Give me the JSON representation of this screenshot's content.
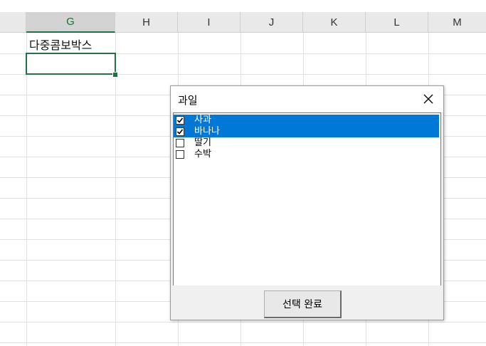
{
  "columns": [
    "G",
    "H",
    "I",
    "J",
    "K",
    "L",
    "M"
  ],
  "selected_column": "G",
  "cell_g1_text": "다중콤보박스",
  "dialog": {
    "title": "과일",
    "close_icon": "close-icon",
    "items": [
      {
        "label": "사과",
        "checked": true,
        "selected": true
      },
      {
        "label": "바나나",
        "checked": true,
        "selected": true
      },
      {
        "label": "딸기",
        "checked": false,
        "selected": false
      },
      {
        "label": "수박",
        "checked": false,
        "selected": false
      }
    ],
    "button_label": "선택 완료"
  },
  "colors": {
    "selection": "#0078d7",
    "excel_green": "#217346"
  }
}
